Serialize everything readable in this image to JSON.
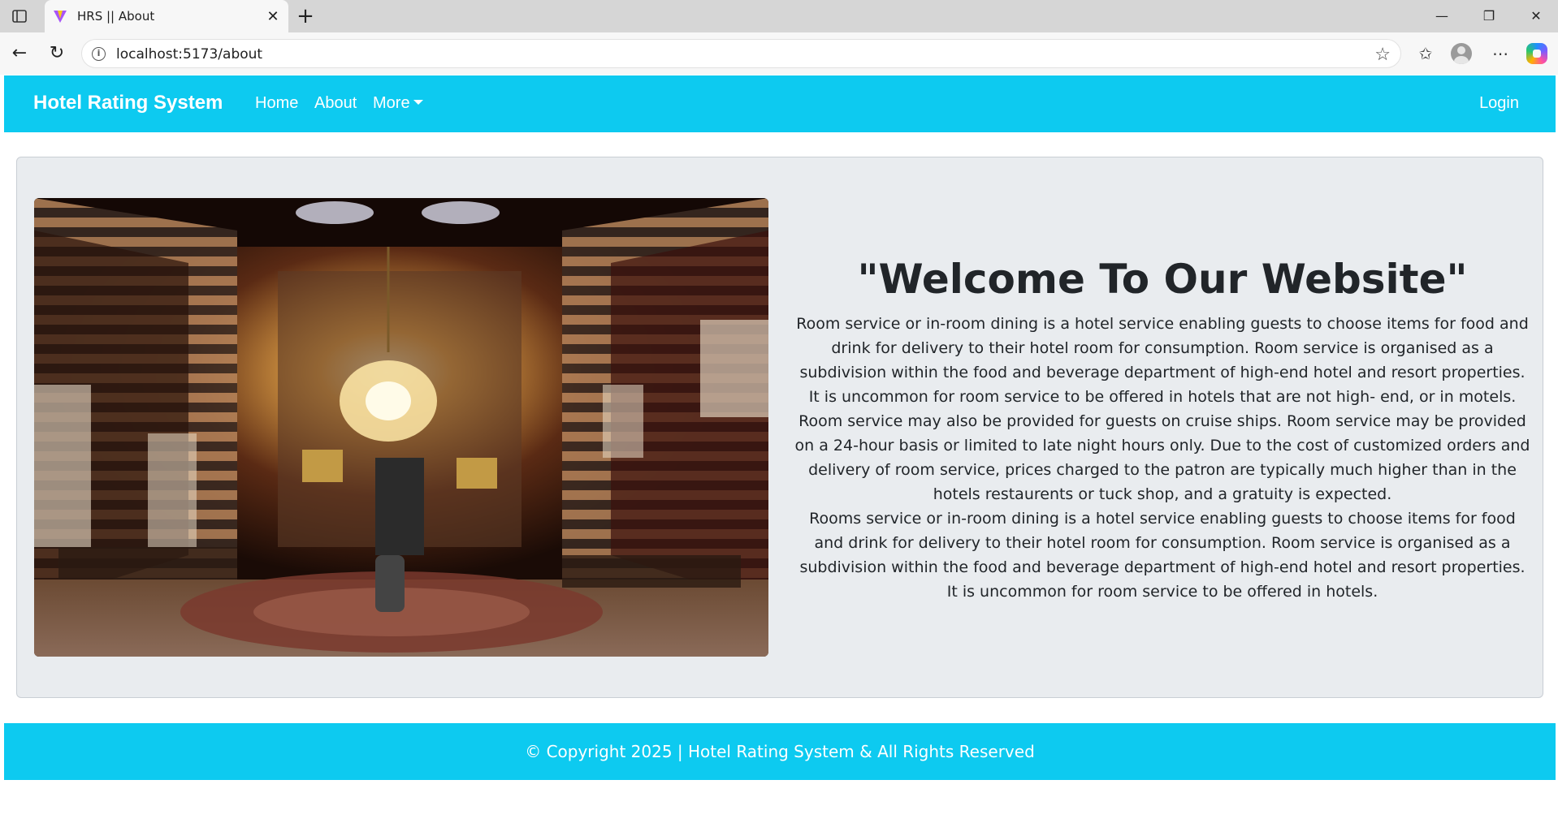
{
  "browser": {
    "tab_title": "HRS || About",
    "url": "localhost:5173/about",
    "new_tab": "+",
    "tab_close": "✕",
    "minimize": "—",
    "restore": "❐",
    "close": "✕"
  },
  "navbar": {
    "brand": "Hotel Rating System",
    "links": [
      "Home",
      "About",
      "More"
    ],
    "login": "Login"
  },
  "about": {
    "heading": "\"Welcome To Our Website\"",
    "paragraph1": "Room service or in-room dining is a hotel service enabling guests to choose items for food and drink for delivery to their hotel room for consumption. Room service is organised as a subdivision within the food and beverage department of high-end hotel and resort properties. It is uncommon for room service to be offered in hotels that are not high- end, or in motels. Room service may also be provided for guests on cruise ships. Room service may be provided on a 24-hour basis or limited to late night hours only. Due to the cost of customized orders and delivery of room service, prices charged to the patron are typically much higher than in the hotels restaurents or tuck shop, and a gratuity is expected.",
    "paragraph2": "Rooms service or in-room dining is a hotel service enabling guests to choose items for food and drink for delivery to their hotel room for consumption. Room service is organised as a subdivision within the food and beverage department of high-end hotel and resort properties. It is uncommon for room service to be offered in hotels."
  },
  "footer": {
    "copyright": "© Copyright 2025 | Hotel Rating System & All Rights Reserved"
  },
  "colors": {
    "primary": "#0dcaf0",
    "card_bg": "#e9ecef",
    "text": "#212529"
  }
}
